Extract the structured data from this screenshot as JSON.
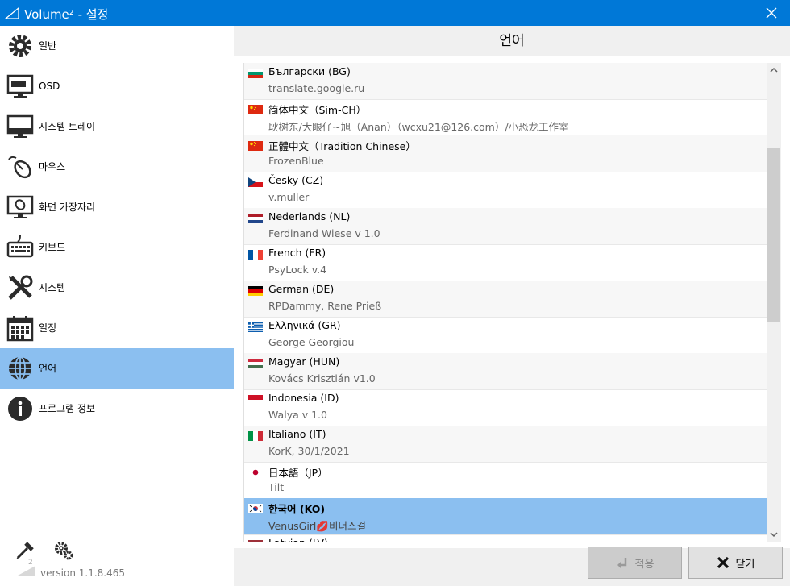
{
  "window": {
    "title": "Volume² - 설정"
  },
  "sidebar": {
    "items": [
      {
        "label": "일반",
        "icon": "gear-icon"
      },
      {
        "label": "OSD",
        "icon": "monitor-icon"
      },
      {
        "label": "시스템 트레이",
        "icon": "tray-icon"
      },
      {
        "label": "마우스",
        "icon": "mouse-icon"
      },
      {
        "label": "화면 가장자리",
        "icon": "screen-edge-icon"
      },
      {
        "label": "키보드",
        "icon": "keyboard-icon"
      },
      {
        "label": "시스템",
        "icon": "tools-icon"
      },
      {
        "label": "일정",
        "icon": "calendar-icon"
      },
      {
        "label": "언어",
        "icon": "globe-icon"
      },
      {
        "label": "프로그램 정보",
        "icon": "info-icon"
      }
    ],
    "active_index": 8,
    "version_logo_text": "2",
    "version": "version 1.1.8.465"
  },
  "main": {
    "title": "언어",
    "languages": [
      {
        "name": "Български (BG)",
        "author": "translate.google.ru",
        "flag": "bg"
      },
      {
        "name": "简体中文（Sim-CH）",
        "author": "耿树东/大眼仔~旭（Anan）（wcxu21@126.com）/小恐龙工作室",
        "flag": "cn"
      },
      {
        "name": "正體中文（Tradition Chinese）",
        "author": "FrozenBlue",
        "flag": "cn"
      },
      {
        "name": "Česky (CZ)",
        "author": "v.muller",
        "flag": "cz"
      },
      {
        "name": "Nederlands (NL)",
        "author": "Ferdinand Wiese v 1.0",
        "flag": "nl"
      },
      {
        "name": "French (FR)",
        "author": "PsyLock v.4",
        "flag": "fr"
      },
      {
        "name": "German (DE)",
        "author": "RPDammy, Rene Prieß",
        "flag": "de"
      },
      {
        "name": "Ελληνικά (GR)",
        "author": "George Georgiou",
        "flag": "gr"
      },
      {
        "name": "Magyar (HUN)",
        "author": "Kovács Krisztián v1.0",
        "flag": "hu"
      },
      {
        "name": "Indonesia (ID)",
        "author": "Walya v 1.0",
        "flag": "id"
      },
      {
        "name": "Italiano (IT)",
        "author": "KorK, 30/1/2021",
        "flag": "it"
      },
      {
        "name": "日本語（JP）",
        "author": "Tilt",
        "flag": "jp"
      },
      {
        "name": "한국어 (KO)",
        "author": "VenusGirl💋비너스걸",
        "flag": "kr"
      },
      {
        "name": "Latvian (LV)",
        "author": "",
        "flag": "lv"
      }
    ],
    "selected_index": 12
  },
  "buttons": {
    "apply": "적용",
    "close": "닫기"
  },
  "colors": {
    "titlebar": "#0078d7",
    "selection": "#8bbff0"
  }
}
